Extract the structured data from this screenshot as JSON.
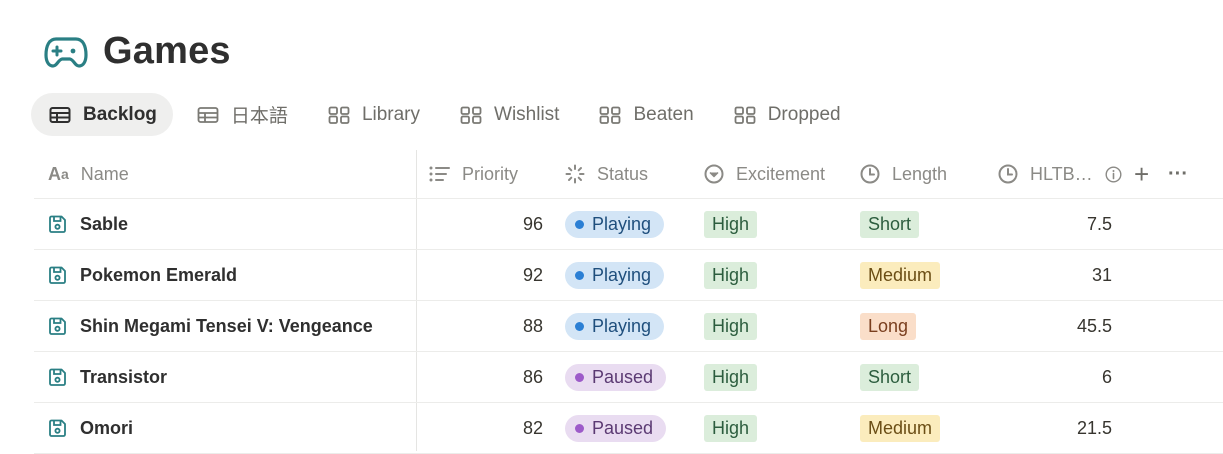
{
  "page": {
    "title": "Games",
    "icon": "gamepad-icon"
  },
  "tabs": [
    {
      "label": "Backlog",
      "icon": "table-icon",
      "active": true
    },
    {
      "label": "日本語",
      "icon": "table-icon",
      "active": false
    },
    {
      "label": "Library",
      "icon": "gallery-icon",
      "active": false
    },
    {
      "label": "Wishlist",
      "icon": "gallery-icon",
      "active": false
    },
    {
      "label": "Beaten",
      "icon": "gallery-icon",
      "active": false
    },
    {
      "label": "Dropped",
      "icon": "gallery-icon",
      "active": false
    }
  ],
  "columns": {
    "name": "Name",
    "priority": "Priority",
    "status": "Status",
    "excitement": "Excitement",
    "length": "Length",
    "hltb": "HLTB…",
    "add": "+",
    "more": "···"
  },
  "colors": {
    "playing_bg": "#d3e5f6",
    "playing_dot": "#2b7fd4",
    "paused_bg": "#e9dcf1",
    "paused_dot": "#9d5bc9",
    "high_bg": "#dbeddb",
    "short_bg": "#dbeddb",
    "medium_bg": "#fbecbd",
    "long_bg": "#fadec9",
    "accent": "#2a7f84"
  },
  "rows": [
    {
      "name": "Sable",
      "priority": "96",
      "status": "Playing",
      "excitement": "High",
      "length": "Short",
      "hltb": "7.5"
    },
    {
      "name": "Pokemon Emerald",
      "priority": "92",
      "status": "Playing",
      "excitement": "High",
      "length": "Medium",
      "hltb": "31"
    },
    {
      "name": "Shin Megami Tensei V: Vengeance",
      "priority": "88",
      "status": "Playing",
      "excitement": "High",
      "length": "Long",
      "hltb": "45.5"
    },
    {
      "name": "Transistor",
      "priority": "86",
      "status": "Paused",
      "excitement": "High",
      "length": "Short",
      "hltb": "6"
    },
    {
      "name": "Omori",
      "priority": "82",
      "status": "Paused",
      "excitement": "High",
      "length": "Medium",
      "hltb": "21.5"
    }
  ]
}
